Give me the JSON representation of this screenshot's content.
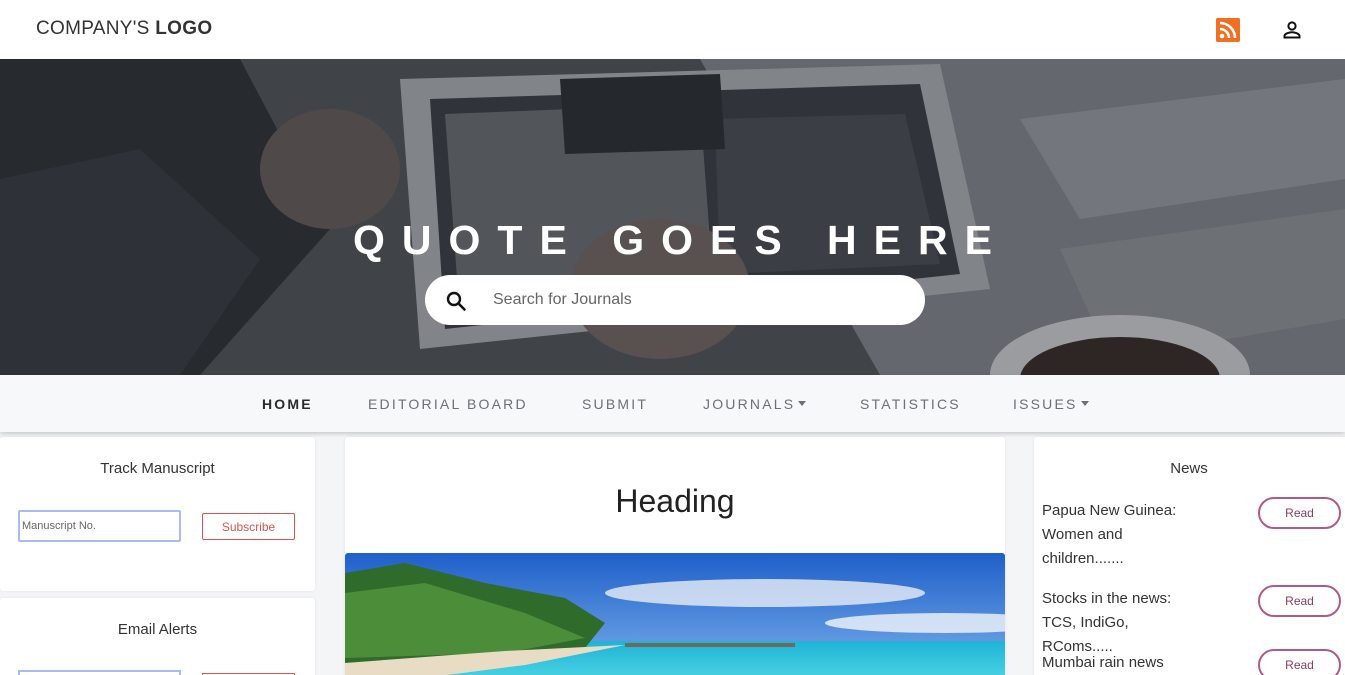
{
  "header": {
    "logo_prefix": "COMPANY'S",
    "logo_bold": "LOGO",
    "rss_color": "#f26f21"
  },
  "hero": {
    "quote": "QUOTE GOES HERE",
    "search_placeholder": "Search for Journals"
  },
  "nav": {
    "items": [
      {
        "label": "HOME",
        "active": true
      },
      {
        "label": "EDITORIAL BOARD"
      },
      {
        "label": "SUBMIT"
      },
      {
        "label": "JOURNALS",
        "dropdown": true
      },
      {
        "label": "STATISTICS"
      },
      {
        "label": "ISSUES",
        "dropdown": true
      }
    ]
  },
  "track": {
    "title": "Track Manuscript",
    "input_placeholder": "Manuscript No.",
    "button_label": "Subscribe"
  },
  "email_alerts": {
    "title": "Email Alerts"
  },
  "main": {
    "heading": "Heading"
  },
  "news": {
    "title": "News",
    "items": [
      {
        "text": "Papua New Guinea: Women and children.......",
        "button": "Read"
      },
      {
        "text": "Stocks in the news: TCS, IndiGo, RComs.....",
        "button": "Read"
      },
      {
        "text": "Mumbai rain news",
        "button": "Read"
      }
    ]
  },
  "colors": {
    "accent_red": "#d9534f",
    "read_button": "#b05a88",
    "input_focus": "#a9bbf0"
  }
}
